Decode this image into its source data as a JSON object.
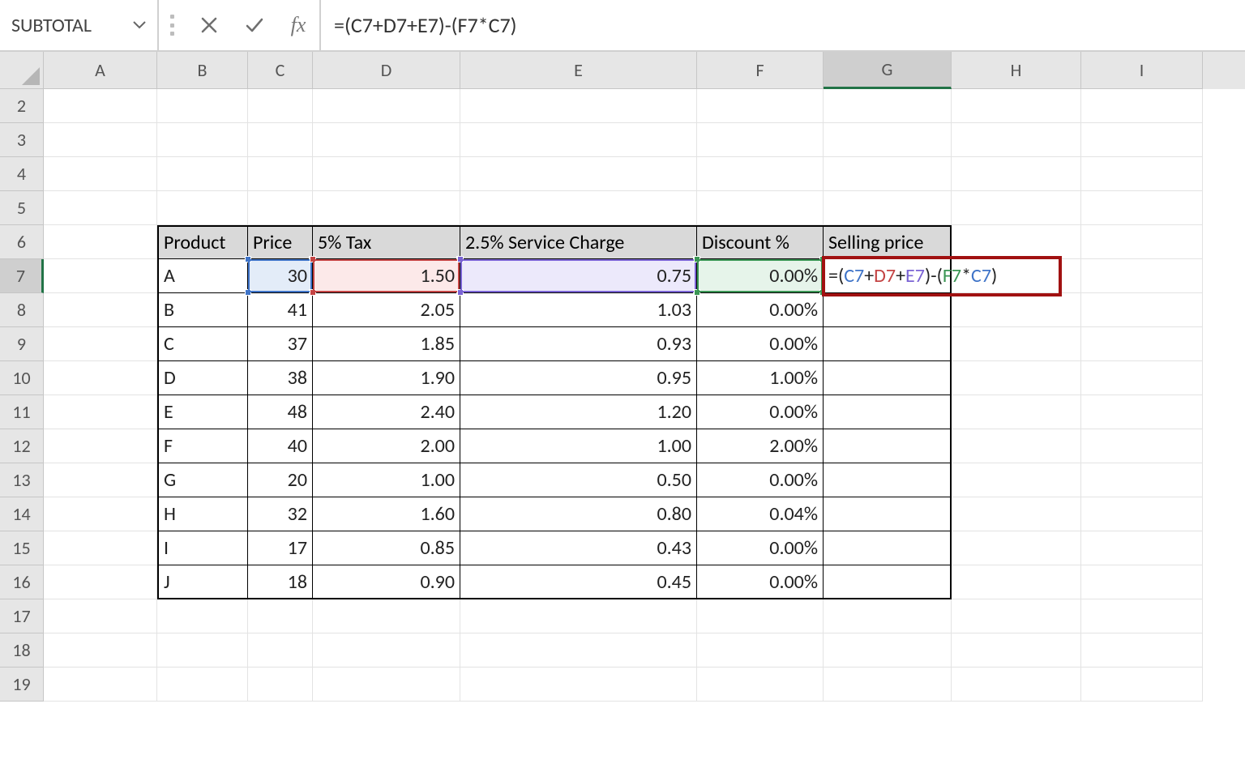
{
  "formula_bar": {
    "name_box": "SUBTOTAL",
    "fx_label": "fx",
    "formula_text": "=(C7+D7+E7)-(F7*C7)"
  },
  "columns": [
    "A",
    "B",
    "C",
    "D",
    "E",
    "F",
    "G",
    "H",
    "I"
  ],
  "active_column": "G",
  "rows": [
    2,
    3,
    4,
    5,
    6,
    7,
    8,
    9,
    10,
    11,
    12,
    13,
    14,
    15,
    16,
    17,
    18,
    19
  ],
  "active_row": 7,
  "table": {
    "headers": {
      "product": "Product",
      "price": "Price",
      "tax": "5% Tax",
      "service": "2.5% Service Charge",
      "discount": "Discount %",
      "selling": "Selling price"
    },
    "rows": [
      {
        "product": "A",
        "price": "30",
        "tax": "1.50",
        "service": "0.75",
        "discount": "0.00%"
      },
      {
        "product": "B",
        "price": "41",
        "tax": "2.05",
        "service": "1.03",
        "discount": "0.00%"
      },
      {
        "product": "C",
        "price": "37",
        "tax": "1.85",
        "service": "0.93",
        "discount": "0.00%"
      },
      {
        "product": "D",
        "price": "38",
        "tax": "1.90",
        "service": "0.95",
        "discount": "1.00%"
      },
      {
        "product": "E",
        "price": "48",
        "tax": "2.40",
        "service": "1.20",
        "discount": "0.00%"
      },
      {
        "product": "F",
        "price": "40",
        "tax": "2.00",
        "service": "1.00",
        "discount": "2.00%"
      },
      {
        "product": "G",
        "price": "20",
        "tax": "1.00",
        "service": "0.50",
        "discount": "0.00%"
      },
      {
        "product": "H",
        "price": "32",
        "tax": "1.60",
        "service": "0.80",
        "discount": "0.04%"
      },
      {
        "product": "I",
        "price": "17",
        "tax": "0.85",
        "service": "0.43",
        "discount": "0.00%"
      },
      {
        "product": "J",
        "price": "18",
        "tax": "0.90",
        "service": "0.45",
        "discount": "0.00%"
      }
    ]
  },
  "editing_cell": {
    "tokens": {
      "eq": "=",
      "lp": "(",
      "rp": ")",
      "plus": "+",
      "minus": "-",
      "star": "*",
      "c7": "C7",
      "d7": "D7",
      "e7": "E7",
      "f7": "F7"
    }
  }
}
